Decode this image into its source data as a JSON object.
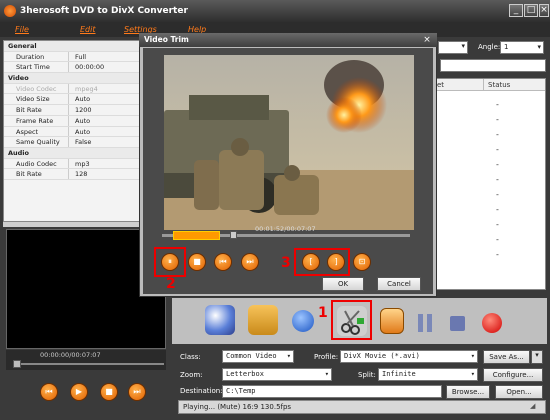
{
  "window": {
    "title": "3herosoft DVD to DivX Converter",
    "min": "_",
    "max": "□",
    "close": "×"
  },
  "menu": [
    "File",
    "Edit",
    "Settings",
    "Help"
  ],
  "properties": [
    {
      "group": "General"
    },
    {
      "k": "Duration",
      "v": "Full"
    },
    {
      "k": "Start Time",
      "v": "00:00:00"
    },
    {
      "group": "Video"
    },
    {
      "k": "Video Codec",
      "v": "mpeg4",
      "dim": true
    },
    {
      "k": "Video Size",
      "v": "Auto"
    },
    {
      "k": "Bit Rate",
      "v": "1200"
    },
    {
      "k": "Frame Rate",
      "v": "Auto"
    },
    {
      "k": "Aspect",
      "v": "Auto"
    },
    {
      "k": "Same Quality",
      "v": "False"
    },
    {
      "group": "Audio"
    },
    {
      "k": "Audio Codec",
      "v": "mp3"
    },
    {
      "k": "Bit Rate",
      "v": "128"
    }
  ],
  "preview": {
    "time": "00:00:00/00:07:07"
  },
  "top_right": {
    "angle_label": "Angle:",
    "angle_value": "1"
  },
  "file_table": {
    "col_partial": "et",
    "col_status": "Status",
    "rows": [
      "-",
      "-",
      "-",
      "-",
      "-",
      "-",
      "-",
      "-",
      "-",
      "-",
      "-"
    ]
  },
  "dialog": {
    "title": "Video Trim",
    "close": "×",
    "time": "00:01:52/00:07:07",
    "ok": "OK",
    "cancel": "Cancel",
    "annotations": {
      "n1": "1",
      "n2": "2",
      "n3": "3"
    }
  },
  "bottom": {
    "class_label": "Class:",
    "class_value": "Common Video",
    "profile_label": "Profile:",
    "profile_value": "DivX Movie  (*.avi)",
    "saveas": "Save As...",
    "zoom_label": "Zoom:",
    "zoom_value": "Letterbox",
    "split_label": "Split:",
    "split_value": "Infinite",
    "configure": "Configure...",
    "dest_label": "Destination:",
    "dest_value": "C:\\Temp",
    "browse": "Browse...",
    "open": "Open..."
  },
  "status": {
    "text": "Playing... (Mute) 16:9  130.5fps"
  }
}
